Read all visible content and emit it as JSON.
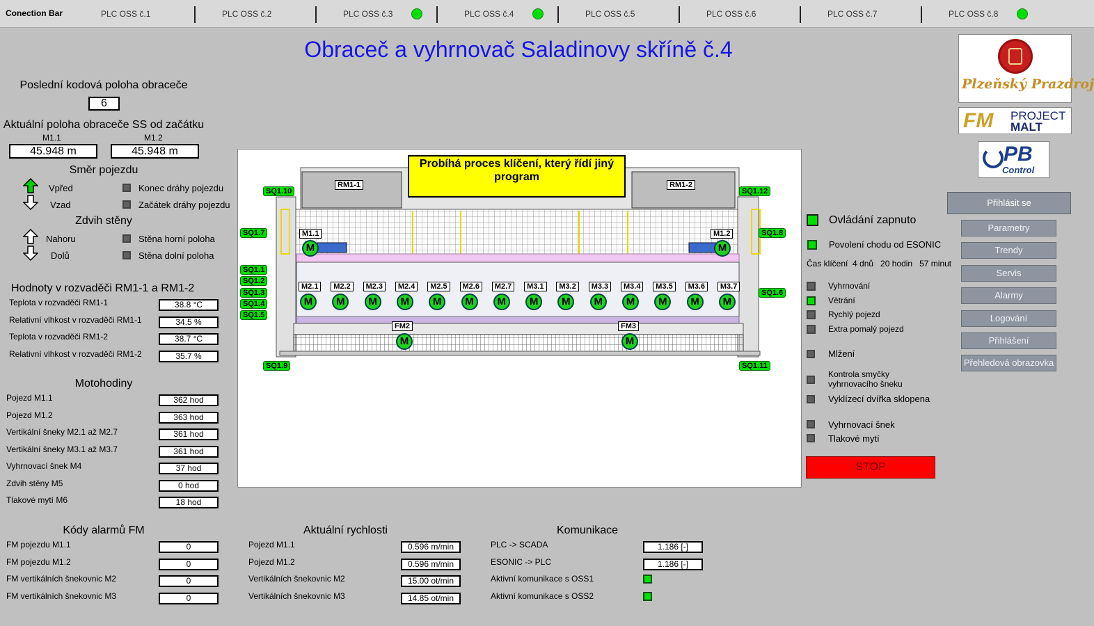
{
  "connection_bar": {
    "title": "Conection Bar",
    "plcs": [
      {
        "label": "PLC OSS č.1",
        "status": false
      },
      {
        "label": "PLC OSS č.2",
        "status": false
      },
      {
        "label": "PLC OSS č.3",
        "status": true
      },
      {
        "label": "PLC OSS č.4",
        "status": true
      },
      {
        "label": "PLC OSS č.5",
        "status": false
      },
      {
        "label": "PLC OSS č.6",
        "status": false
      },
      {
        "label": "PLC OSS č.7",
        "status": false
      },
      {
        "label": "PLC OSS č.8",
        "status": true
      }
    ]
  },
  "title": "Obraceč a vyhrnovač Saladinovy skříně č.4",
  "logos": {
    "brand1": "Plzeňský Prazdroj",
    "brand2_a": "FM",
    "brand2_b": "PROJECT",
    "brand2_c": "MALT",
    "brand3_a": "PB",
    "brand3_b": "Control"
  },
  "left": {
    "last_position_label": "Poslední kodová poloha obraceče",
    "last_position_value": "6",
    "current_position_label": "Aktuální poloha obraceče SS od začátku",
    "m11_label": "M1.1",
    "m12_label": "M1.2",
    "m11_value": "45.948 m",
    "m12_value": "45.948 m",
    "travel_dir_title": "Směr pojezdu",
    "forward": "Vpřed",
    "backward": "Vzad",
    "track_end": "Konec dráhy pojezdu",
    "track_start": "Začátek dráhy pojezdu",
    "wall_lift_title": "Zdvih stěny",
    "up": "Nahoru",
    "down": "Dolů",
    "wall_top": "Stěna horní poloha",
    "wall_bottom": "Stěna dolní poloha"
  },
  "rm": {
    "title": "Hodnoty v rozvaděči RM1-1 a RM1-2",
    "rows": [
      {
        "label": "Teplota v rozvaděči RM1-1",
        "value": "38.8 °C"
      },
      {
        "label": "Relativní vlhkost v rozvaděči RM1-1",
        "value": "34.5 %"
      },
      {
        "label": "Teplota v rozvaděči RM1-2",
        "value": "38.7 °C"
      },
      {
        "label": "Relativní vlhkost v rozvaděči RM1-2",
        "value": "35.7 %"
      }
    ]
  },
  "hours": {
    "title": "Motohodiny",
    "rows": [
      {
        "label": "Pojezd M1.1",
        "value": "362 hod"
      },
      {
        "label": "Pojezd M1.2",
        "value": "363 hod"
      },
      {
        "label": "Vertikální šneky M2.1 až M2.7",
        "value": "361 hod"
      },
      {
        "label": "Vertikální šneky M3.1 až M3.7",
        "value": "361 hod"
      },
      {
        "label": "Vyhrnovací šnek M4",
        "value": "37 hod"
      },
      {
        "label": "Zdvih stěny M5",
        "value": "0 hod"
      },
      {
        "label": "Tlakové mytí M6",
        "value": "18 hod"
      }
    ]
  },
  "alarms": {
    "title": "Kódy alarmů FM",
    "rows": [
      {
        "label": "FM pojezdu M1.1",
        "value": "0"
      },
      {
        "label": "FM pojezdu M1.2",
        "value": "0"
      },
      {
        "label": "FM vertikálních šnekovnic M2",
        "value": "0"
      },
      {
        "label": "FM vertikálních šnekovnic M3",
        "value": "0"
      }
    ]
  },
  "speeds": {
    "title": "Aktuální rychlosti",
    "rows": [
      {
        "label": "Pojezd M1.1",
        "value": "0.596 m/min"
      },
      {
        "label": "Pojezd M1.2",
        "value": "0.596 m/min"
      },
      {
        "label": "Vertikálních šnekovnic M2",
        "value": "15.00 ot/min"
      },
      {
        "label": "Vertikálních šnekovnic M3",
        "value": "14.85 ot/min"
      }
    ]
  },
  "comm": {
    "title": "Komunikace",
    "rows": [
      {
        "label": "PLC -> SCADA",
        "value": "1.186 [-]"
      },
      {
        "label": "ESONIC -> PLC",
        "value": "1.186 [-]"
      },
      {
        "label": "Aktivní komunikace s OSS1",
        "value": ""
      },
      {
        "label": "Aktivní komunikace s OSS2",
        "value": ""
      }
    ]
  },
  "diagram": {
    "banner": "Probíhá proces klíčení, který řídí jiný program",
    "rm11": "RM1-1",
    "rm12": "RM1-2",
    "tags": {
      "sq110": "SQ1.10",
      "sq112": "SQ1.12",
      "sq17": "SQ1.7",
      "sq18": "SQ1.8",
      "sq11": "SQ1.1",
      "sq12": "SQ1.2",
      "sq13": "SQ1.3",
      "sq14": "SQ1.4",
      "sq15": "SQ1.5",
      "sq16": "SQ1.6",
      "sq19": "SQ1.9",
      "sq111": "SQ1.11"
    },
    "m11": "M1.1",
    "m12": "M1.2",
    "motors_row": [
      "M2.1",
      "M2.2",
      "M2.3",
      "M2.4",
      "M2.5",
      "M2.6",
      "M2.7",
      "M3.1",
      "M3.2",
      "M3.3",
      "M3.4",
      "M3.5",
      "M3.6",
      "M3.7"
    ],
    "fm2": "FM2",
    "fm3": "FM3",
    "motor_letter": "M"
  },
  "status": {
    "control_on": "Ovládání zapnuto",
    "esonic": "Povolení chodu od ESONIC",
    "time": "Čas klíčení  4 dnů   20 hodin   57 minut",
    "items": [
      {
        "label": "Vyhrnování",
        "active": false
      },
      {
        "label": "Větrání",
        "active": true
      },
      {
        "label": "Rychlý pojezd",
        "active": false
      },
      {
        "label": "Extra pomalý pojezd",
        "active": false
      }
    ],
    "mlzeni": "Mlžení",
    "kontrola": "Kontrola smyčky\nvyhrnovacího šneku",
    "vyklizeci": "Vyklízecí dvířka sklopena",
    "vyhrnovaci_snek": "Vyhrnovací šnek",
    "tlakove": "Tlakové mytí",
    "stop": "STOP"
  },
  "nav": {
    "login": "Přihlásit se",
    "items": [
      "Parametry",
      "Trendy",
      "Servis",
      "Alarmy",
      "Logování",
      "Přihlášení",
      "Přehledová obrazovka"
    ]
  }
}
